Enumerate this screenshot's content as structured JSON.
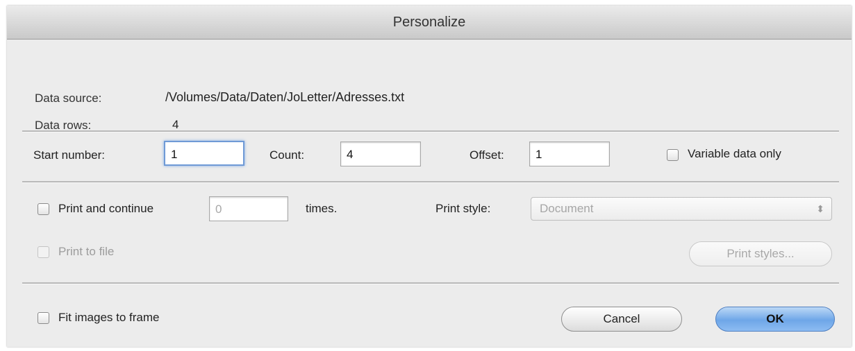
{
  "window": {
    "title": "Personalize"
  },
  "info": {
    "data_source_label": "Data source:",
    "data_source_value": "/Volumes/Data/Daten/JoLetter/Adresses.txt",
    "data_rows_label": "Data rows:",
    "data_rows_value": "4"
  },
  "range": {
    "start_label": "Start number:",
    "start_value": "1",
    "count_label": "Count:",
    "count_value": "4",
    "offset_label": "Offset:",
    "offset_value": "1",
    "variable_label": "Variable data only"
  },
  "print": {
    "continue_label": "Print and continue",
    "times_value": "0",
    "times_label": "times.",
    "style_label": "Print style:",
    "style_value": "Document",
    "to_file_label": "Print to file",
    "styles_button": "Print styles..."
  },
  "footer": {
    "fit_label": "Fit images to frame",
    "cancel": "Cancel",
    "ok": "OK"
  },
  "colors": {
    "primary_button": "#6ea6e8",
    "focus_ring": "#6f9ad6"
  }
}
